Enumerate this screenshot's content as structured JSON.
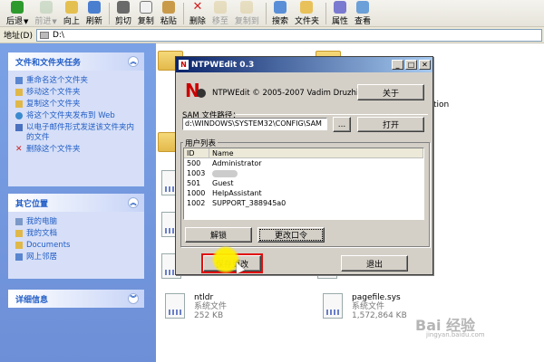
{
  "toolbar": {
    "back": "后退",
    "forward": "前进",
    "up": "向上",
    "refresh": "刷新",
    "cut": "剪切",
    "copy": "复制",
    "paste": "粘贴",
    "delete": "删除",
    "move_to": "移至",
    "copy_to": "复制到",
    "search": "搜索",
    "folders": "文件夹",
    "properties": "属性",
    "views": "查看"
  },
  "address": {
    "label": "地址(D)",
    "value": "D:\\"
  },
  "sidebar": {
    "file_tasks": {
      "title": "文件和文件夹任务",
      "items": [
        "重命名这个文件夹",
        "移动这个文件夹",
        "复制这个文件夹",
        "将这个文件夹发布到 Web",
        "以电子邮件形式发送该文件夹内的文件",
        "删除这个文件夹"
      ]
    },
    "other_places": {
      "title": "其它位置",
      "items": [
        "我的电脑",
        "我的文档",
        "Documents",
        "网上邻居"
      ]
    },
    "details": {
      "title": "详细信息"
    }
  },
  "files": {
    "ntldr": {
      "name": "ntldr",
      "type": "系统文件",
      "size": "252 KB"
    },
    "pagefile": {
      "name": "pagefile.sys",
      "type": "系统文件",
      "size": "1,572,864 KB"
    },
    "tail_text": "tion"
  },
  "dialog": {
    "title": "NTPWEdit 0.3",
    "copyright": "NTPWEdit © 2005-2007 Vadim Druzhin",
    "about_button": "关于",
    "sam_label": "SAM 文件路径：",
    "sam_path": "d:\\WINDOWS\\SYSTEM32\\CONFIG\\SAM",
    "browse_button": "...",
    "open_button": "打开",
    "users_label": "用户列表",
    "columns": [
      "ID",
      "Name"
    ],
    "users": [
      {
        "id": "500",
        "name": "Administrator"
      },
      {
        "id": "1003",
        "name": ""
      },
      {
        "id": "501",
        "name": "Guest"
      },
      {
        "id": "1000",
        "name": "HelpAssistant"
      },
      {
        "id": "1002",
        "name": "SUPPORT_388945a0"
      }
    ],
    "unlock_button": "解锁",
    "change_password_button": "更改口令",
    "save_button": "保存更改",
    "exit_button": "退出"
  },
  "watermark": {
    "logo": "Bai 经验",
    "url": "jingyan.baidu.com"
  },
  "colors": {
    "taskpane": "#7aa1e6",
    "title_active": "#0a246a",
    "highlight": "#e01010"
  }
}
